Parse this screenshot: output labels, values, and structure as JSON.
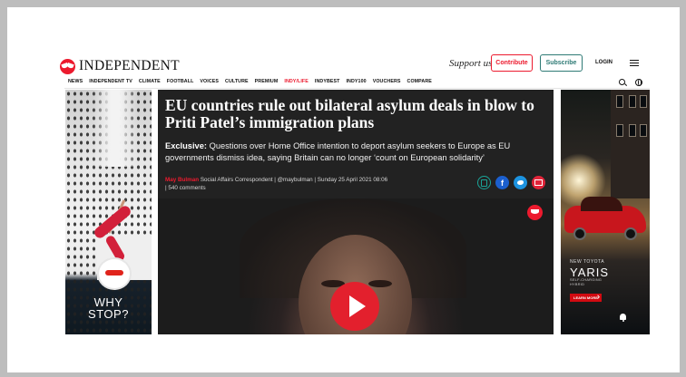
{
  "header": {
    "logo_text": "INDEPENDENT",
    "support_text": "Support us",
    "contribute_label": "Contribute",
    "subscribe_label": "Subscribe",
    "login_label": "LOGIN"
  },
  "nav": {
    "items": [
      "NEWS",
      "INDEPENDENT TV",
      "CLIMATE",
      "FOOTBALL",
      "VOICES",
      "CULTURE",
      "PREMIUM",
      "INDY/LIFE",
      "INDYBEST",
      "INDY100",
      "VOUCHERS",
      "COMPARE"
    ]
  },
  "article": {
    "headline": "EU countries rule out bilateral asylum deals in blow to Priti Patel’s immigration plans",
    "standfirst_lead": "Exclusive:",
    "standfirst_text": " Questions over Home Office intention to deport asylum seekers to Europe as EU governments dismiss idea, saying Britain can no longer ‘count on European solidarity’",
    "author": "May Bulman",
    "byline_rest": " Social Affairs Correspondent | @maybulman | Sunday 25 April 2021 08:06",
    "comments": "| 540 comments"
  },
  "ads": {
    "left_text": "WHY\nSTOP?",
    "right_small": "NEW TOYOTA",
    "right_model": "YARIS",
    "right_sub": "SELF-CHARGING\nHYBRID",
    "right_cta": "LEARN MORE"
  },
  "colors": {
    "brand_red": "#ec1a2e",
    "subscribe_teal": "#2e7a75",
    "article_bg": "#222222"
  }
}
